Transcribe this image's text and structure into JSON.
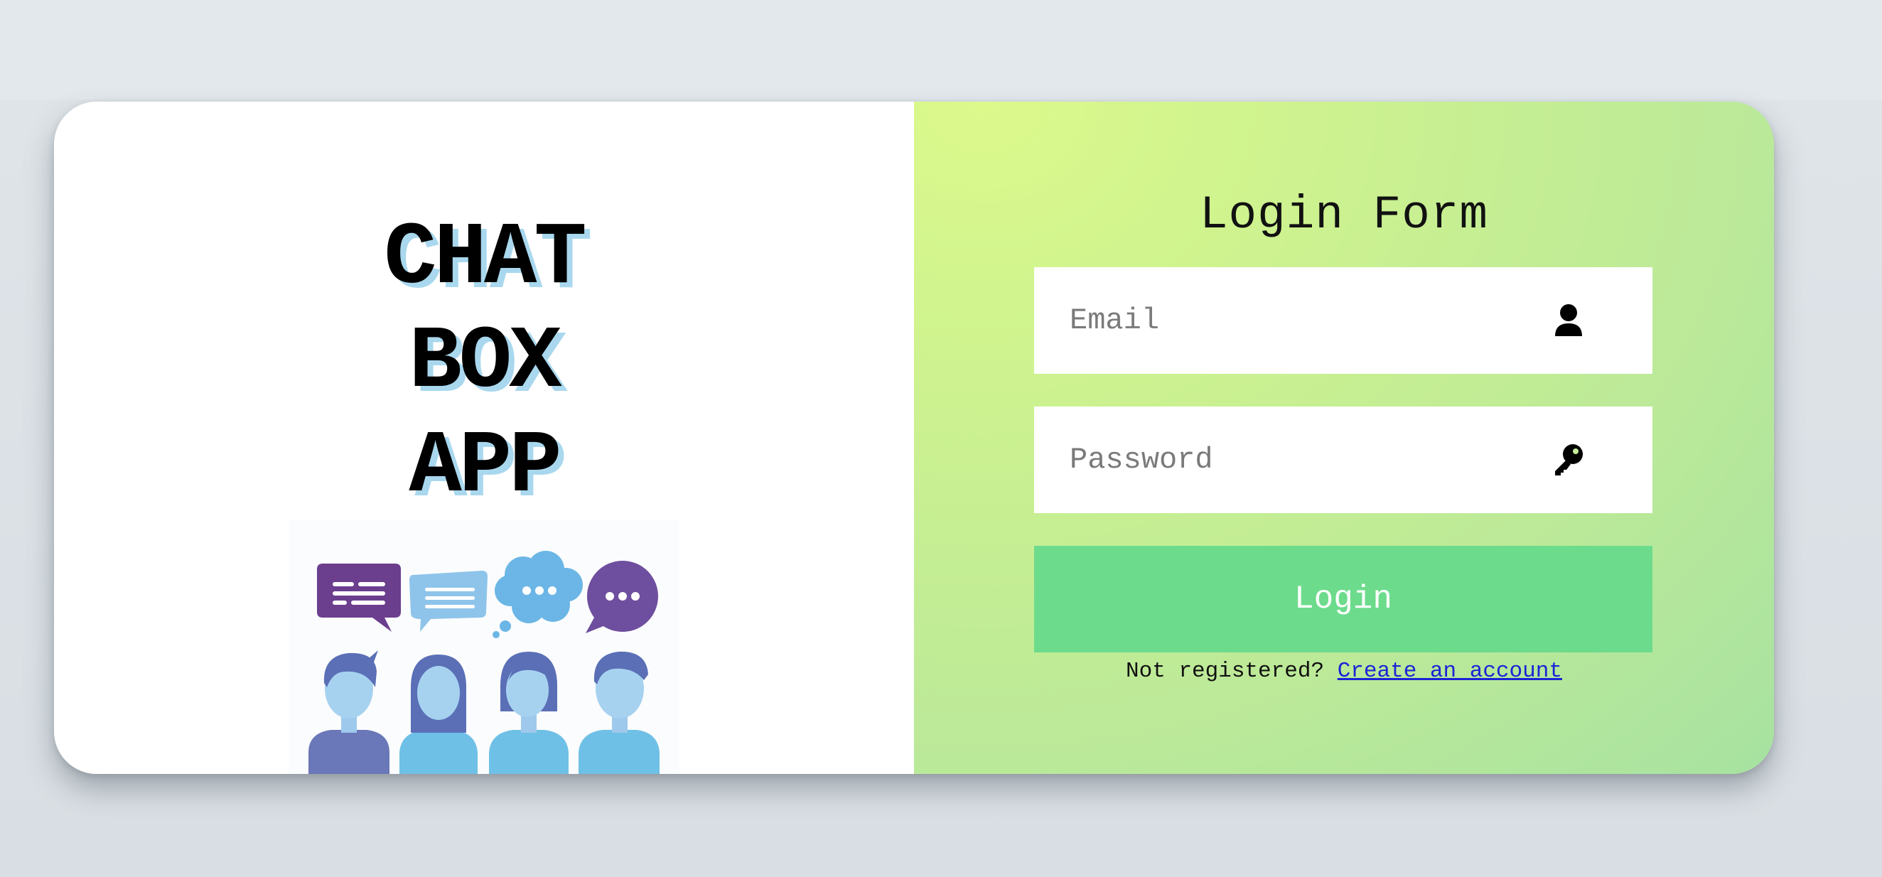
{
  "brand": {
    "lines": [
      "CHAT",
      "BOX",
      "APP"
    ],
    "shadow_color": "#a9d8ee"
  },
  "illustration": {
    "description_icon": "chat-people-illustration"
  },
  "form": {
    "title": "Login Form",
    "email": {
      "placeholder": "Email",
      "value": "",
      "icon": "user-icon"
    },
    "password": {
      "placeholder": "Password",
      "value": "",
      "icon": "key-icon"
    },
    "submit_label": "Login",
    "register_prompt": "Not registered?",
    "register_link": "Create an account"
  },
  "colors": {
    "button": "#6ddb8c",
    "link": "#1a24d6",
    "panel_gradient_start": "#dcf98c",
    "panel_gradient_end": "#a7e2a1"
  }
}
